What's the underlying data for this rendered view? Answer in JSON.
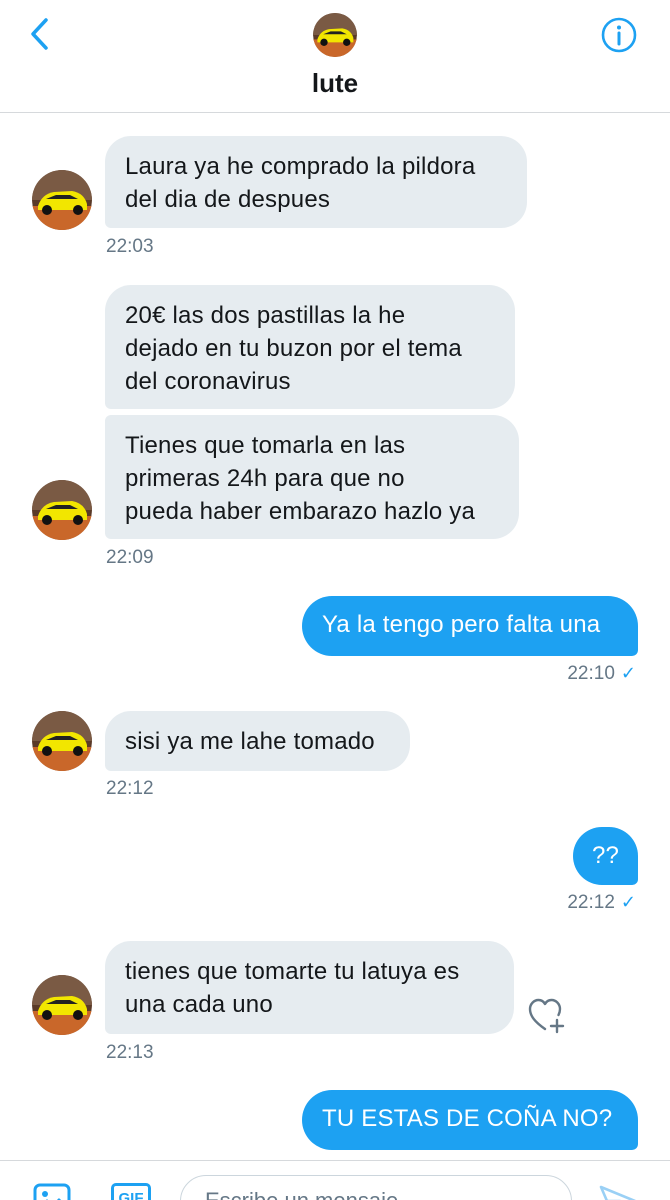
{
  "header": {
    "name": "lute"
  },
  "messages": [
    {
      "direction": "in",
      "lines": [
        "Laura ya he comprado la pildora",
        "del dia de despues"
      ],
      "time": "22:03"
    },
    {
      "direction": "in",
      "lines": [
        "20€ las dos pastillas la he",
        "dejado en tu buzon por el tema",
        "del coronavirus"
      ]
    },
    {
      "direction": "in",
      "lines": [
        "Tienes que tomarla en las",
        "primeras 24h para que no",
        "pueda haber embarazo hazlo ya"
      ],
      "time": "22:09"
    },
    {
      "direction": "out",
      "text": "Ya la tengo pero falta una",
      "time": "22:10",
      "status": "✓"
    },
    {
      "direction": "in",
      "lines": [
        "sisi ya me lahe tomado"
      ],
      "time": "22:12"
    },
    {
      "direction": "out",
      "text": "??",
      "time": "22:12",
      "status": "✓"
    },
    {
      "direction": "in",
      "lines": [
        "tienes que tomarte tu latuya es",
        "una cada uno"
      ],
      "time": "22:13"
    },
    {
      "direction": "out",
      "text": "TU ESTAS DE COÑA NO?"
    }
  ],
  "composer": {
    "gif_label": "GIF",
    "placeholder": "Escribe un mensaje"
  },
  "icons": {
    "back": "chevron-left-icon",
    "info": "info-icon",
    "like": "heart-plus-icon",
    "media": "image-icon",
    "send": "send-icon"
  },
  "colors": {
    "accent": "#1da1f2",
    "incoming_bubble": "#e6ecf0",
    "text": "#14171a",
    "muted": "#657786",
    "avatar_car": "#f2e600"
  }
}
